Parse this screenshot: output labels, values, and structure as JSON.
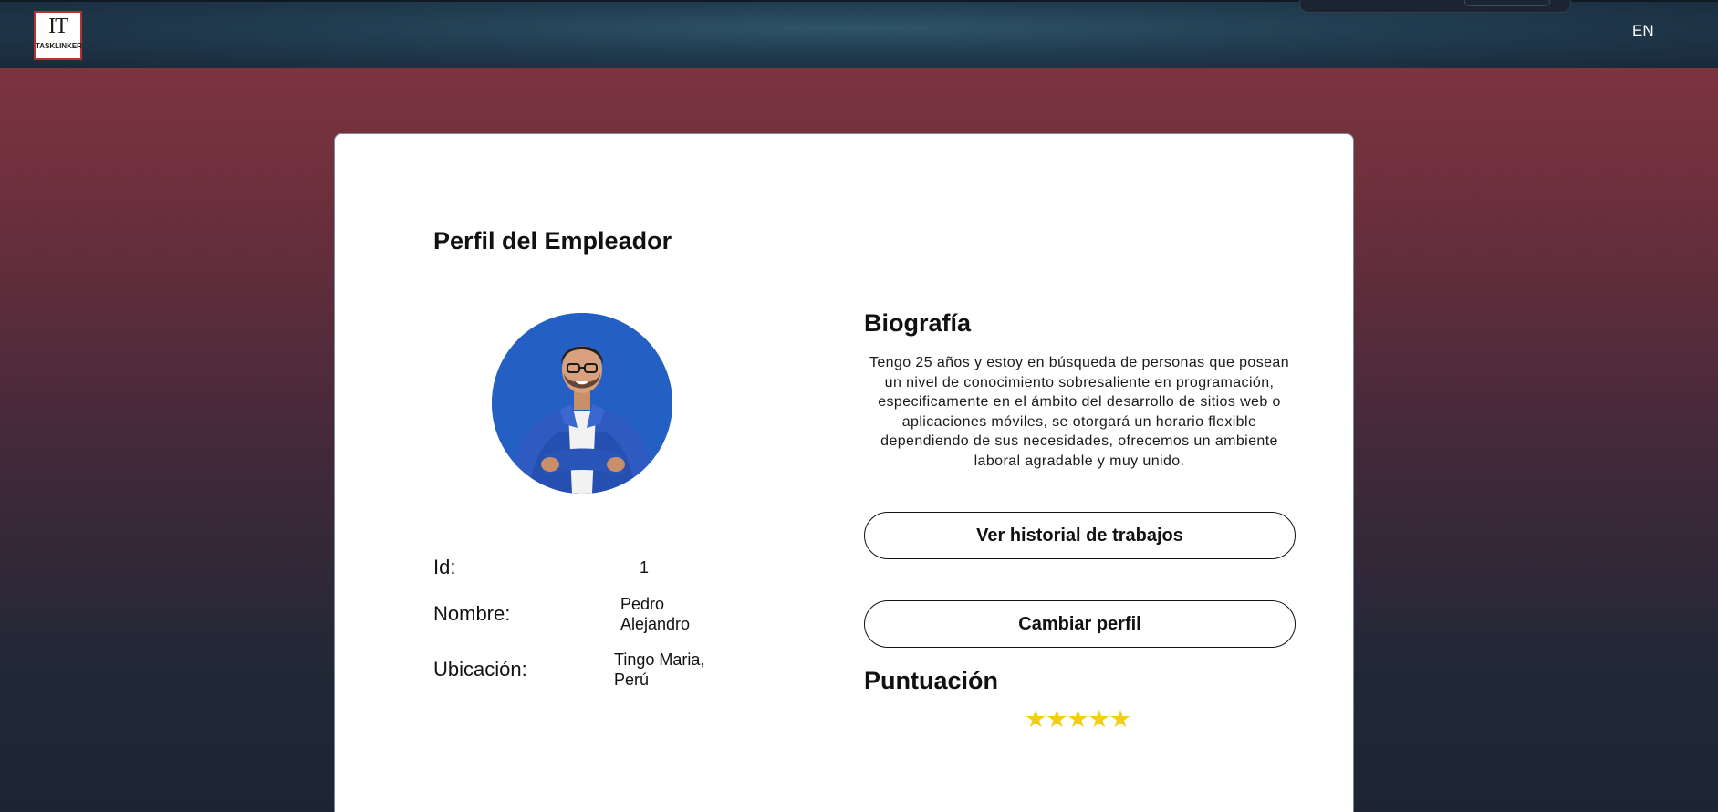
{
  "header": {
    "logo_mark": "IT",
    "logo_text": "TASKLINKER",
    "language": "EN"
  },
  "profile": {
    "title": "Perfil del Empleador",
    "fields": {
      "id_label": "Id:",
      "id_value": "1",
      "name_label": "Nombre:",
      "name_line1": "Pedro",
      "name_line2": "Alejandro",
      "location_label": "Ubicación:",
      "location_line1": "Tingo Maria,",
      "location_line2": "Perú"
    }
  },
  "bio": {
    "title": "Biografía",
    "text": "Tengo 25 años y estoy en búsqueda de personas que posean un nivel de conocimiento sobresaliente en programación, especificamente en el ámbito del desarrollo de sitios web o aplicaciones móviles, se otorgará un horario flexible dependiendo de sus necesidades, ofrecemos un ambiente laboral agradable y muy unido."
  },
  "actions": {
    "history_button": "Ver historial de trabajos",
    "change_profile_button": "Cambiar perfil"
  },
  "rating": {
    "title": "Puntuación",
    "stars": 5,
    "max_stars": 5,
    "star_glyph": "★★★★★"
  },
  "colors": {
    "accent_star": "#f2cf14",
    "avatar_background": "#2460c4",
    "logo_border": "#b1342f"
  }
}
